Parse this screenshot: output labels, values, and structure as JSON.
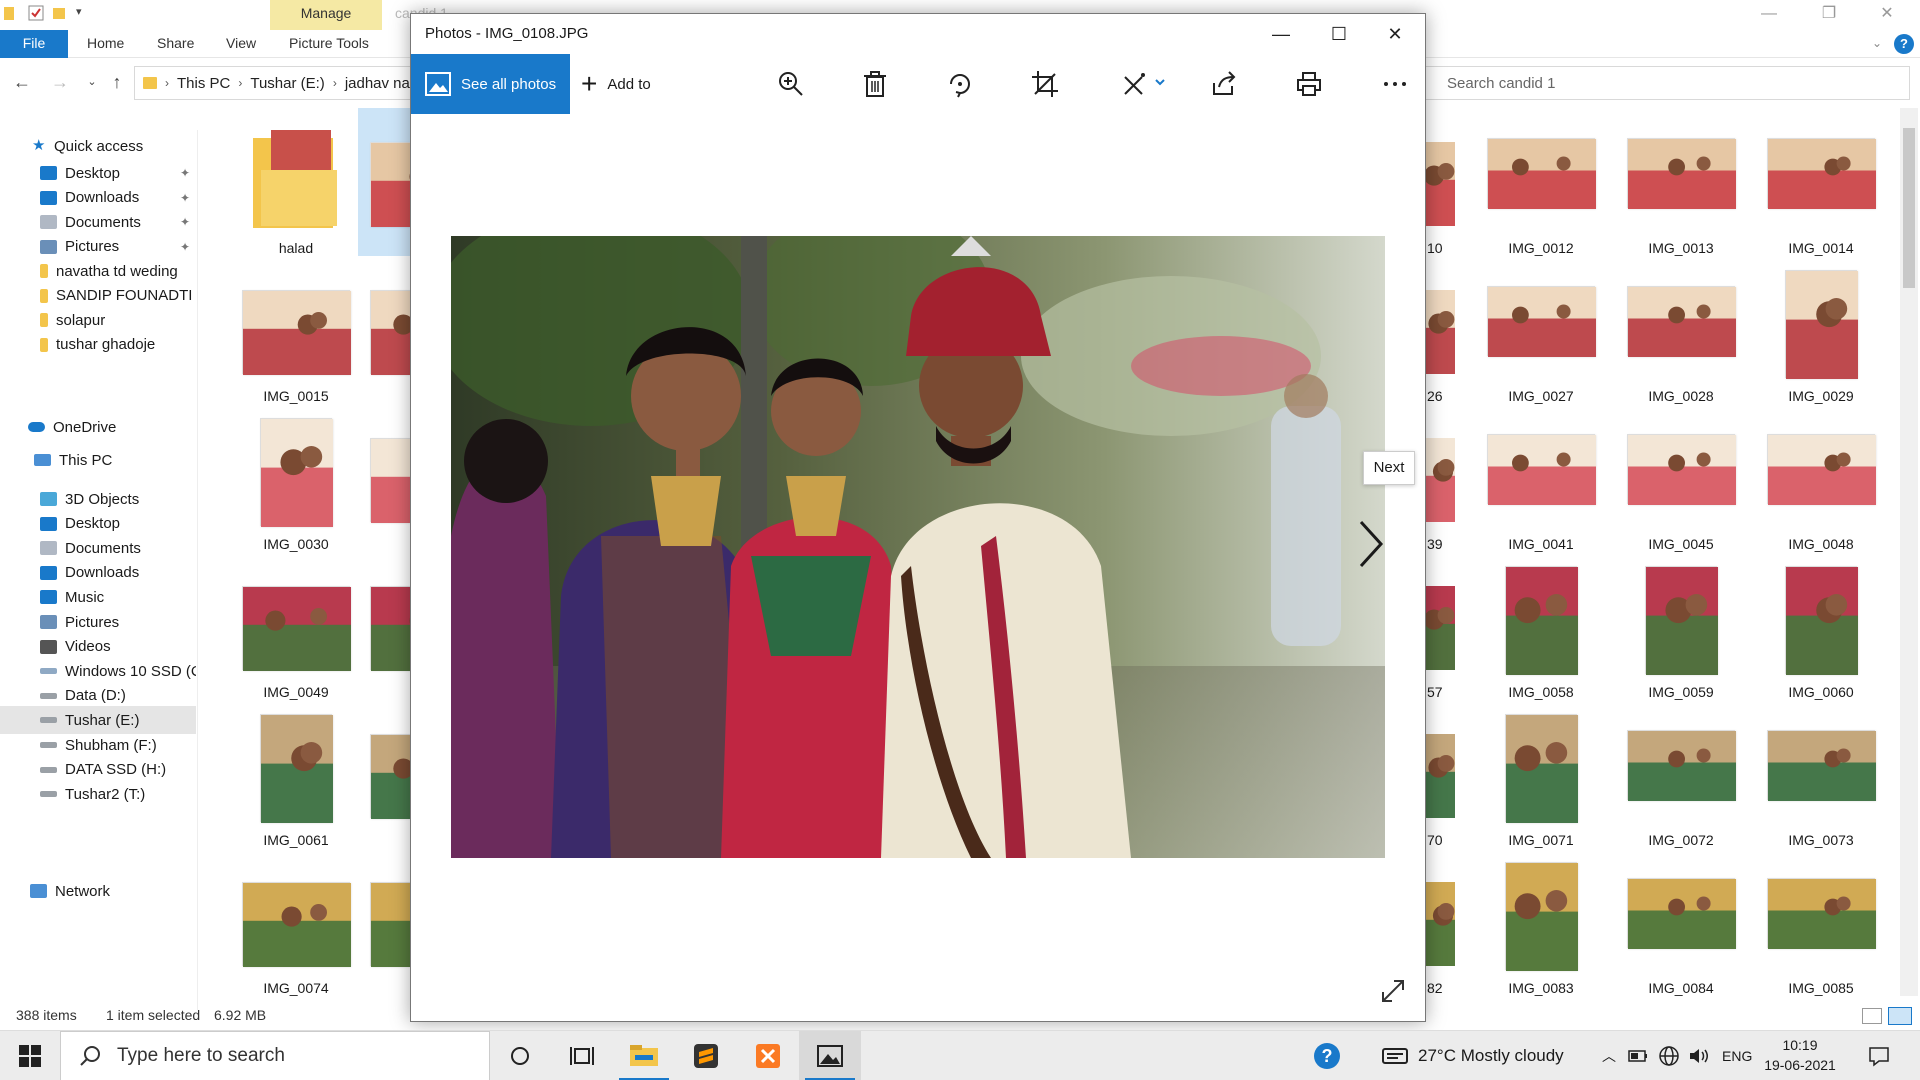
{
  "explorer": {
    "manage_tab": "Manage",
    "faded_title": "candid 1",
    "tabs": [
      "File",
      "Home",
      "Share",
      "View",
      "Picture Tools"
    ],
    "breadcrumb": [
      "This PC",
      "Tushar (E:)",
      "jadhav na"
    ],
    "search_placeholder": "Search candid 1",
    "nav": {
      "quick_access": "Quick access",
      "quick_items": [
        "Desktop",
        "Downloads",
        "Documents",
        "Pictures",
        "navatha td weding",
        "SANDIP FOUNADTI",
        "solapur",
        "tushar ghadoje"
      ],
      "onedrive": "OneDrive",
      "this_pc": "This PC",
      "pc_items": [
        "3D Objects",
        "Desktop",
        "Documents",
        "Downloads",
        "Music",
        "Pictures",
        "Videos",
        "Windows 10 SSD (C",
        "Data (D:)",
        "Tushar (E:)",
        "Shubham (F:)",
        "DATA SSD (H:)",
        "Tushar2 (T:)"
      ],
      "network": "Network"
    },
    "left_thumbs": [
      "halad",
      "IMG",
      "IMG_0015",
      "IMG",
      "IMG_0030",
      "IMG",
      "IMG_0049",
      "IMG",
      "IMG_0061",
      "IMG",
      "IMG_0074",
      "IMG"
    ],
    "partial_labels": [
      "10",
      "26",
      "39",
      "57",
      "70",
      "82"
    ],
    "right_thumbs": [
      [
        "IMG_0012",
        "IMG_0013",
        "IMG_0014"
      ],
      [
        "IMG_0027",
        "IMG_0028",
        "IMG_0029"
      ],
      [
        "IMG_0041",
        "IMG_0045",
        "IMG_0048"
      ],
      [
        "IMG_0058",
        "IMG_0059",
        "IMG_0060"
      ],
      [
        "IMG_0071",
        "IMG_0072",
        "IMG_0073"
      ],
      [
        "IMG_0083",
        "IMG_0084",
        "IMG_0085"
      ]
    ],
    "status": {
      "count": "388 items",
      "selected": "1 item selected",
      "size": "6.92 MB"
    }
  },
  "photos": {
    "title": "Photos - IMG_0108.JPG",
    "see_all": "See all photos",
    "add_to": "Add to",
    "next_tooltip": "Next"
  },
  "taskbar": {
    "search_placeholder": "Type here to search",
    "weather": "27°C  Mostly cloudy",
    "lang": "ENG",
    "time": "10:19",
    "date": "19-06-2021"
  },
  "colors": {
    "accent": "#1979ca",
    "manage_tab": "#f5e9a4",
    "selection": "#cce4f7"
  }
}
